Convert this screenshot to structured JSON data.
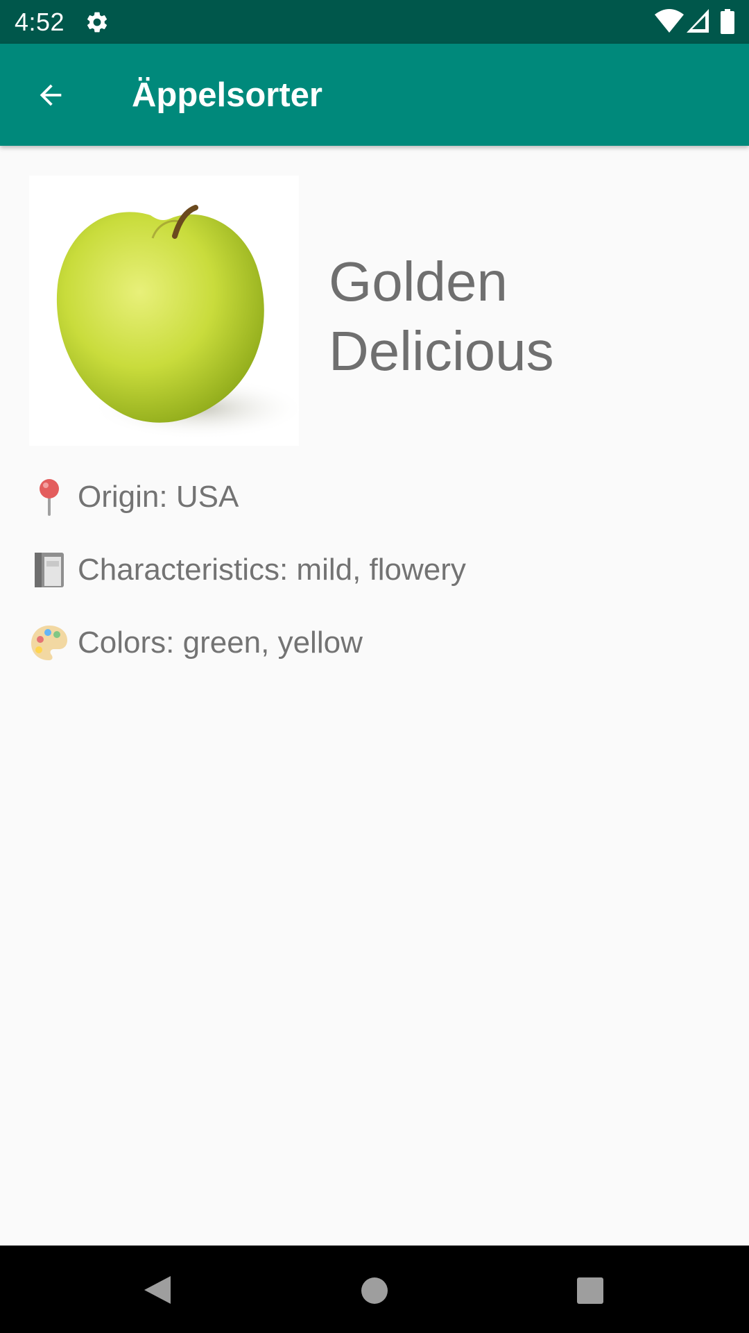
{
  "status_bar": {
    "time": "4:52",
    "icons": [
      "gear-icon",
      "wifi-icon",
      "signal-icon",
      "battery-icon"
    ]
  },
  "app_bar": {
    "title": "Äppelsorter",
    "back_icon": "arrow-back-icon",
    "background_color": "#00897b"
  },
  "apple": {
    "image": "green-yellow-apple-photo",
    "name": "Golden Delicious",
    "details": [
      {
        "icon": "round-pushpin-icon",
        "text": "Origin: USA"
      },
      {
        "icon": "notebook-icon",
        "text": "Characteristics: mild, flowery"
      },
      {
        "icon": "palette-icon",
        "text": "Colors: green, yellow"
      }
    ]
  },
  "nav_bar": {
    "icons": [
      "nav-back-icon",
      "nav-home-icon",
      "nav-recents-icon"
    ]
  },
  "colors": {
    "status_bar": "#00574b",
    "app_bar": "#00897b",
    "background": "#fafafa",
    "text": "#737373"
  }
}
